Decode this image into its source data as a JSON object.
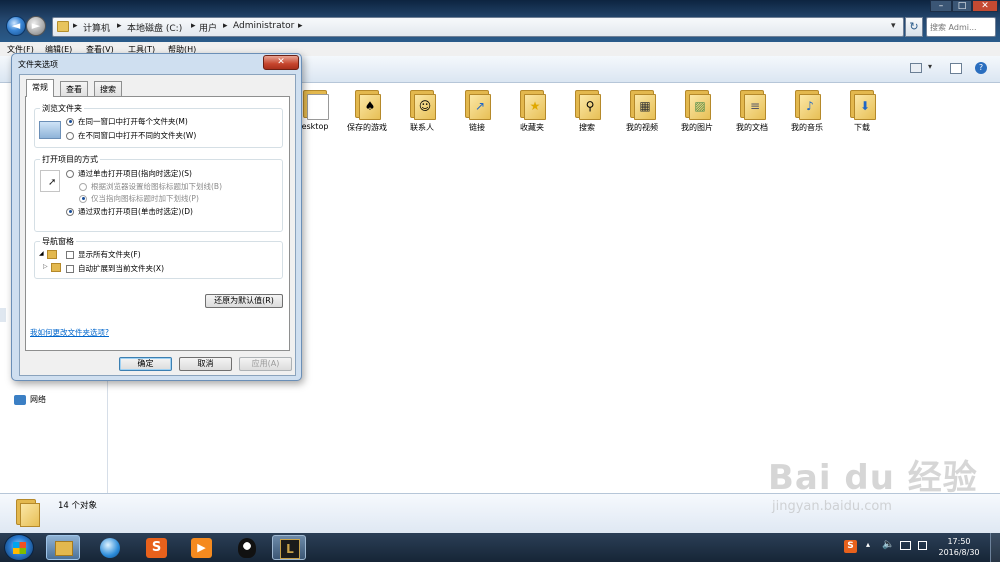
{
  "window": {
    "address": [
      "计算机",
      "本地磁盘 (C:)",
      "用户",
      "Administrator"
    ],
    "search_placeholder": "搜索 Admi...",
    "controls": [
      "–",
      "□",
      "✕"
    ]
  },
  "menu": [
    "文件(F)",
    "编辑(E)",
    "查看(V)",
    "工具(T)",
    "帮助(H)"
  ],
  "folders": [
    {
      "label": "esktop",
      "icon": "desktop-folder-icon",
      "sym": ""
    },
    {
      "label": "保存的游戏",
      "icon": "saved-games-folder-icon",
      "sym": "♠"
    },
    {
      "label": "联系人",
      "icon": "contacts-folder-icon",
      "sym": "☺"
    },
    {
      "label": "链接",
      "icon": "links-folder-icon",
      "sym": "↗"
    },
    {
      "label": "收藏夹",
      "icon": "favorites-folder-icon",
      "sym": "★"
    },
    {
      "label": "搜索",
      "icon": "searches-folder-icon",
      "sym": "⚲"
    },
    {
      "label": "我的视频",
      "icon": "videos-folder-icon",
      "sym": "▦"
    },
    {
      "label": "我的图片",
      "icon": "pictures-folder-icon",
      "sym": "▨"
    },
    {
      "label": "我的文档",
      "icon": "documents-folder-icon",
      "sym": "≡"
    },
    {
      "label": "我的音乐",
      "icon": "music-folder-icon",
      "sym": "♪"
    },
    {
      "label": "下载",
      "icon": "downloads-folder-icon",
      "sym": "⬇"
    }
  ],
  "leftpane": {
    "network": "网络"
  },
  "status": {
    "count": "14 个对象"
  },
  "taskbar": {
    "time": "17:50",
    "date": "2016/8/30"
  },
  "dialog": {
    "title": "文件夹选项",
    "tabs": [
      "常规",
      "查看",
      "搜索"
    ],
    "browse": {
      "title": "浏览文件夹",
      "opt1": "在同一窗口中打开每个文件夹(M)",
      "opt2": "在不同窗口中打开不同的文件夹(W)"
    },
    "click": {
      "title": "打开项目的方式",
      "opt1": "通过单击打开项目(指向时选定)(S)",
      "sub1": "根据浏览器设置给图标标题加下划线(B)",
      "sub2": "仅当指向图标标题时加下划线(P)",
      "opt2": "通过双击打开项目(单击时选定)(D)"
    },
    "nav": {
      "title": "导航窗格",
      "opt1": "显示所有文件夹(F)",
      "opt2": "自动扩展到当前文件夹(X)"
    },
    "restore": "还原为默认值(R)",
    "help_link": "我如何更改文件夹选项?",
    "ok": "确定",
    "cancel": "取消",
    "apply": "应用(A)"
  },
  "watermark": {
    "brand": "Bai du 经验",
    "url": "jingyan.baidu.com"
  }
}
